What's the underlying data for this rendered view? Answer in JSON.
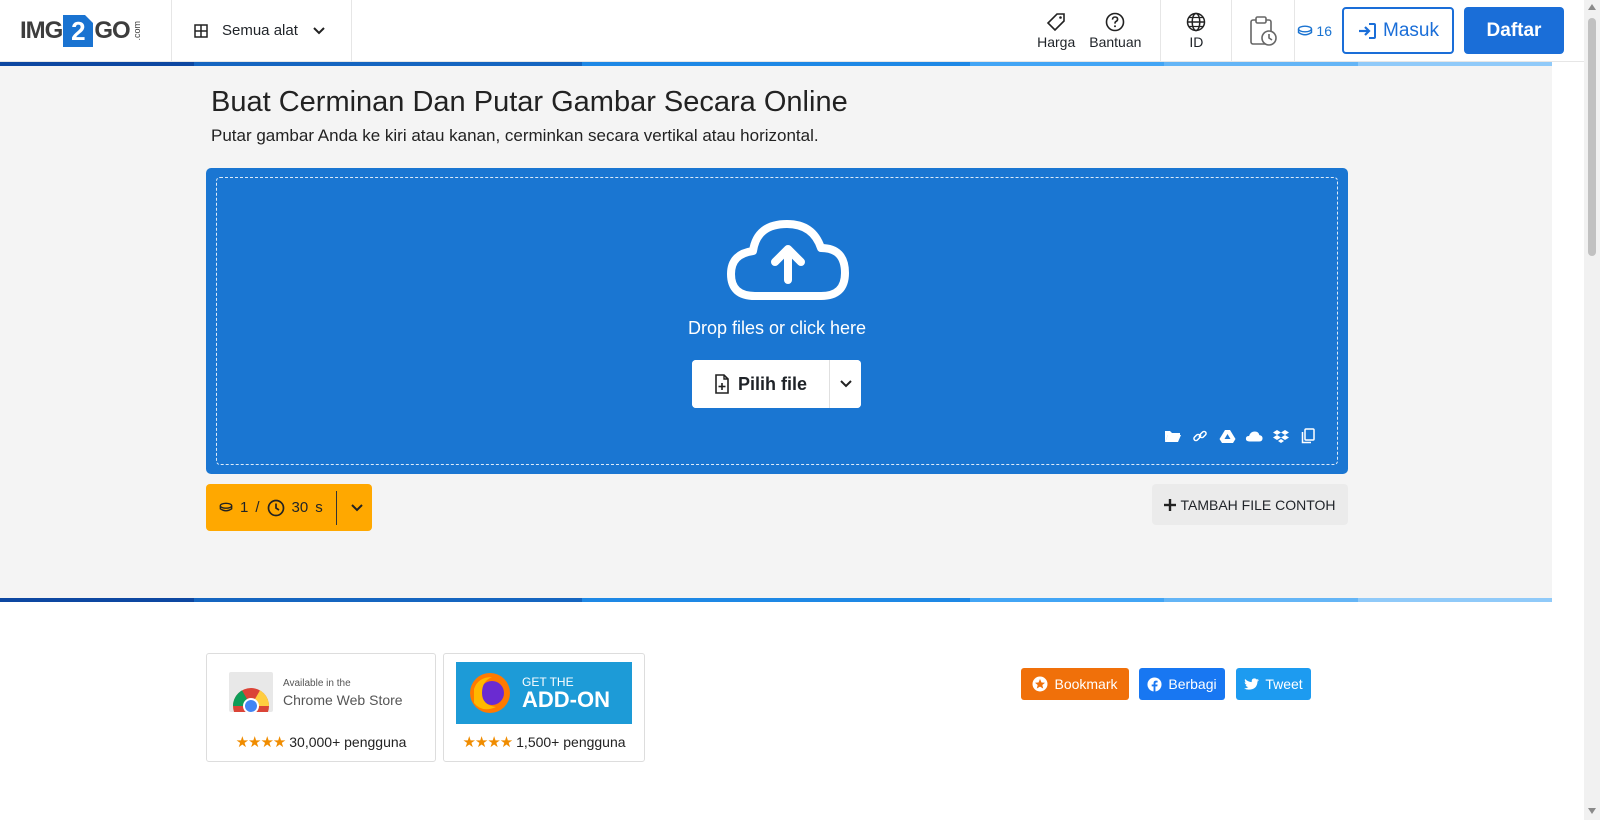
{
  "header": {
    "logo": {
      "pre": "IMG",
      "mid": "2",
      "post": "GO",
      "suffix": ".com"
    },
    "tools_menu": {
      "label": "Semua alat",
      "icon": "grid-icon"
    },
    "nav": [
      {
        "label": "Harga",
        "icon": "tag-icon"
      },
      {
        "label": "Bantuan",
        "icon": "question-icon"
      }
    ],
    "language": {
      "label": "ID",
      "icon": "globe-icon"
    },
    "history_icon": "clipboard-clock-icon",
    "credits": {
      "count": "16",
      "icon": "coins-icon"
    },
    "login_label": "Masuk",
    "register_label": "Daftar"
  },
  "main": {
    "title": "Buat Cerminan Dan Putar Gambar Secara Online",
    "subtitle": "Putar gambar Anda ke kiri atau kanan, cerminkan secara vertikal atau horizontal.",
    "dropzone": {
      "text": "Drop files or click here",
      "choose_label": "Pilih file",
      "sources": [
        "folder-icon",
        "link-icon",
        "google-drive-icon",
        "onedrive-icon",
        "dropbox-icon",
        "clipboard-icon"
      ]
    },
    "cost": {
      "credits": "1",
      "separator": "/",
      "time": "30",
      "unit": "s"
    },
    "sample_label": "TAMBAH FILE CONTOH"
  },
  "extensions": {
    "chrome": {
      "available": "Available in the",
      "store": "Chrome Web Store",
      "stars": "★★★★",
      "users": "30,000+ pengguna"
    },
    "firefox": {
      "line1": "GET THE",
      "line2": "ADD-ON",
      "stars": "★★★★",
      "users": "1,500+ pengguna"
    }
  },
  "share": {
    "bookmark": "Bookmark",
    "facebook": "Berbagi",
    "tweet": "Tweet"
  },
  "colors": {
    "primary": "#1a6ed8",
    "dropzone": "#1a76d2",
    "cost_button": "#ffa800",
    "bookmark": "#f0700a",
    "facebook": "#1877f2",
    "twitter": "#1d9bf0"
  }
}
